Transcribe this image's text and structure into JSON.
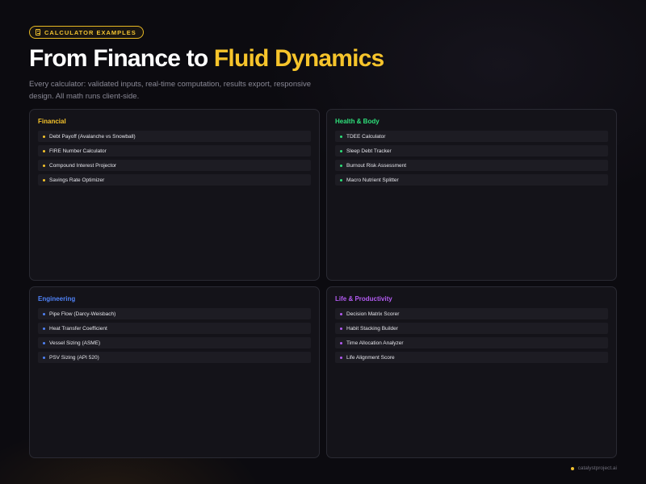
{
  "badge": {
    "icon": "calculator-icon",
    "label": "CALCULATOR EXAMPLES"
  },
  "heading": {
    "part1": "From Finance to ",
    "part2": "Fluid Dynamics"
  },
  "subtitle": "Every calculator: validated inputs, real-time computation, results export, responsive design. All math runs client-side.",
  "colors": {
    "financial": "#f6c42b",
    "health": "#2ee07a",
    "engineering": "#4f82f7",
    "life": "#b35bf2"
  },
  "cards": [
    {
      "title": "Financial",
      "items": [
        "Debt Payoff (Avalanche vs Snowball)",
        "FIRE Number Calculator",
        "Compound Interest Projector",
        "Savings Rate Optimizer"
      ]
    },
    {
      "title": "Health & Body",
      "items": [
        "TDEE Calculator",
        "Sleep Debt Tracker",
        "Burnout Risk Assessment",
        "Macro Nutrient Splitter"
      ]
    },
    {
      "title": "Engineering",
      "items": [
        "Pipe Flow (Darcy-Weisbach)",
        "Heat Transfer Coefficient",
        "Vessel Sizing (ASME)",
        "PSV Sizing (API 520)"
      ]
    },
    {
      "title": "Life & Productivity",
      "items": [
        "Decision Matrix Scorer",
        "Habit Stacking Builder",
        "Time Allocation Analyzer",
        "Life Alignment Score"
      ]
    }
  ],
  "footer": {
    "text": "catalystproject.ai"
  }
}
